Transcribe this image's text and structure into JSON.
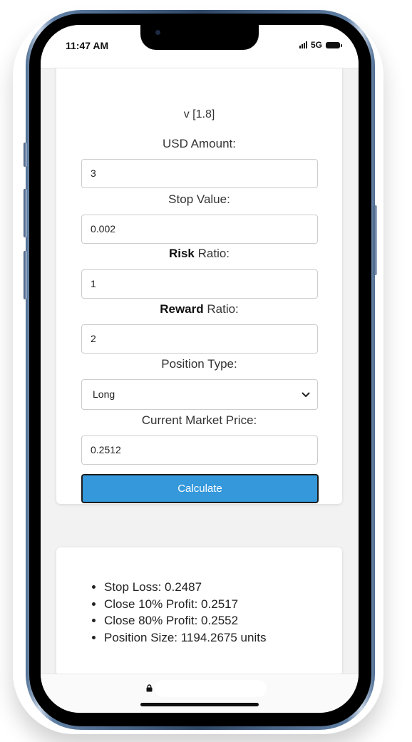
{
  "status": {
    "time": "11:47 AM",
    "network": "5G"
  },
  "form": {
    "version": "v [1.8]",
    "usd_label": "USD Amount:",
    "usd_value": "3",
    "stop_label": "Stop Value:",
    "stop_value": "0.002",
    "risk_label_bold": "Risk",
    "risk_label_rest": " Ratio:",
    "risk_value": "1",
    "reward_label_bold": "Reward",
    "reward_label_rest": " Ratio:",
    "reward_value": "2",
    "position_label": "Position Type:",
    "position_value": "Long",
    "market_label": "Current Market Price:",
    "market_value": "0.2512",
    "calculate_label": "Calculate"
  },
  "results": {
    "stop_loss": "Stop Loss: 0.2487",
    "close_10": "Close 10% Profit: 0.2517",
    "close_80": "Close 80% Profit: 0.2552",
    "position_size": "Position Size: 1194.2675 units"
  },
  "icons": {
    "lock": "lock-icon",
    "chevron": "chevron-down-icon",
    "signal": "signal-icon",
    "battery": "battery-icon"
  },
  "colors": {
    "button": "#3498db",
    "background": "#f2f2f2"
  }
}
